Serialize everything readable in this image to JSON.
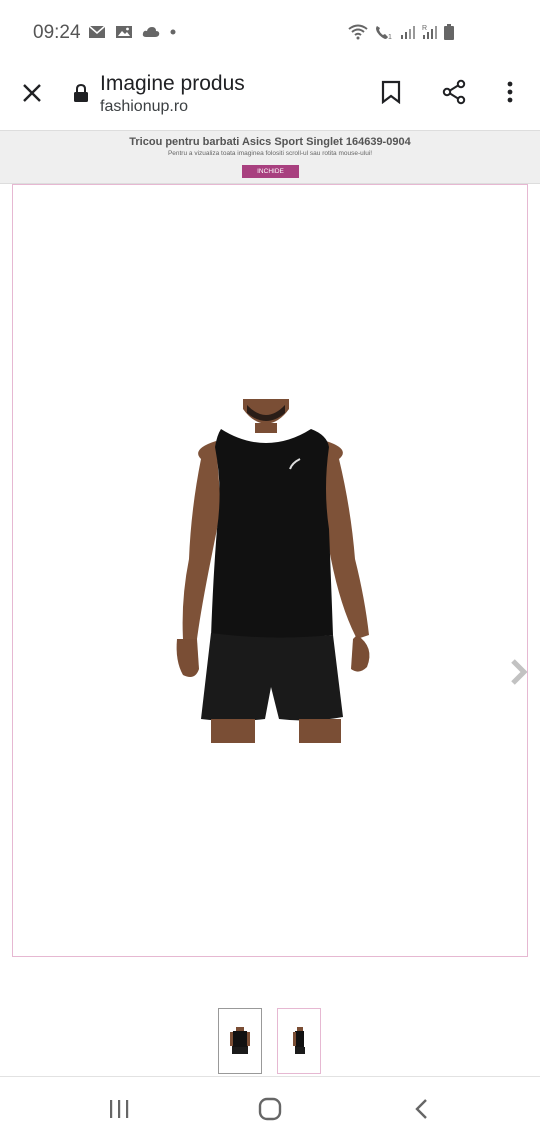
{
  "status_bar": {
    "time": "09:24",
    "left_icons": [
      "mail-icon",
      "image-icon",
      "cloud-icon",
      "dot-icon"
    ],
    "right_icons": [
      "wifi-icon",
      "wifi-calling-icon",
      "signal-icon",
      "signal-roaming-icon",
      "battery-icon"
    ]
  },
  "toolbar": {
    "title": "Imagine produs",
    "url": "fashionup.ro",
    "close_icon": "close-icon",
    "lock_icon": "lock-icon",
    "bookmark_icon": "bookmark-icon",
    "share_icon": "share-icon",
    "menu_icon": "more-vert-icon"
  },
  "banner": {
    "title": "Tricou pentru barbati Asics Sport Singlet 164639-0904",
    "hint": "Pentru a vizualiza toata imaginea folositi scroll-ul sau rotita mouse-ului!",
    "close_label": "INCHIDE",
    "close_color": "#a8407f"
  },
  "gallery": {
    "frame_color": "#e6b8d2",
    "next_icon": "chevron-right-icon",
    "thumbnails": [
      {
        "name": "front-view",
        "selected": true
      },
      {
        "name": "side-view",
        "selected": false
      }
    ]
  },
  "nav_bar": {
    "recents_icon": "recents-icon",
    "home_icon": "home-icon",
    "back_icon": "back-icon"
  }
}
